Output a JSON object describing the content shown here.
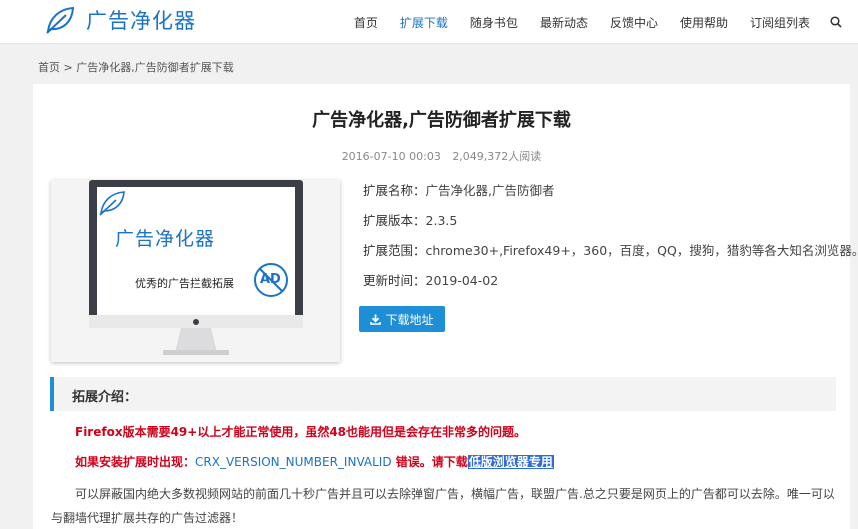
{
  "site": {
    "logo_text": "广告净化器",
    "brand_color": "#1a73c7",
    "accent_color": "#1e8fd6"
  },
  "nav": [
    {
      "label": "首页",
      "active": false
    },
    {
      "label": "扩展下载",
      "active": true
    },
    {
      "label": "随身书包",
      "active": false
    },
    {
      "label": "最新动态",
      "active": false
    },
    {
      "label": "反馈中心",
      "active": false
    },
    {
      "label": "使用帮助",
      "active": false
    },
    {
      "label": "订阅组列表",
      "active": false
    }
  ],
  "breadcrumb": {
    "home": "首页",
    "sep": " > ",
    "current": "广告净化器,广告防御者扩展下载"
  },
  "article": {
    "title": "广告净化器,广告防御者扩展下载",
    "date": "2016-07-10 00:03",
    "views": "2,049,372人阅读"
  },
  "thumbnail": {
    "brand": "广告净化器",
    "tagline": "优秀的广告拦截拓展",
    "badge": "AD"
  },
  "info": {
    "name_label": "扩展名称：",
    "name_value": "广告净化器,广告防御者",
    "version_label": "扩展版本：",
    "version_value": "2.3.5",
    "scope_label": "扩展范围：",
    "scope_value": "chrome30+,Firefox49+，360，百度，QQ，搜狗，猎豹等各大知名浏览器。",
    "updated_label": "更新时间：",
    "updated_value": "2019-04-02"
  },
  "download_button": "下载地址",
  "section": {
    "title": "拓展介绍："
  },
  "notes": {
    "line1": "Firefox版本需要49+以上才能正常使用，虽然48也能用但是会存在非常多的问题。",
    "line2_prefix": "如果安装扩展时出现：",
    "line2_code": "CRX_VERSION_NUMBER_INVALID",
    "line2_mid": " 错误。请下载",
    "line2_link": "低版浏览器专用"
  },
  "paragraph": "可以屏蔽国内绝大多数视频网站的前面几十秒广告并且可以去除弹窗广告，横幅广告，联盟广告.总之只要是网页上的广告都可以去除。唯一可以与翻墙代理扩展共存的广告过滤器！"
}
